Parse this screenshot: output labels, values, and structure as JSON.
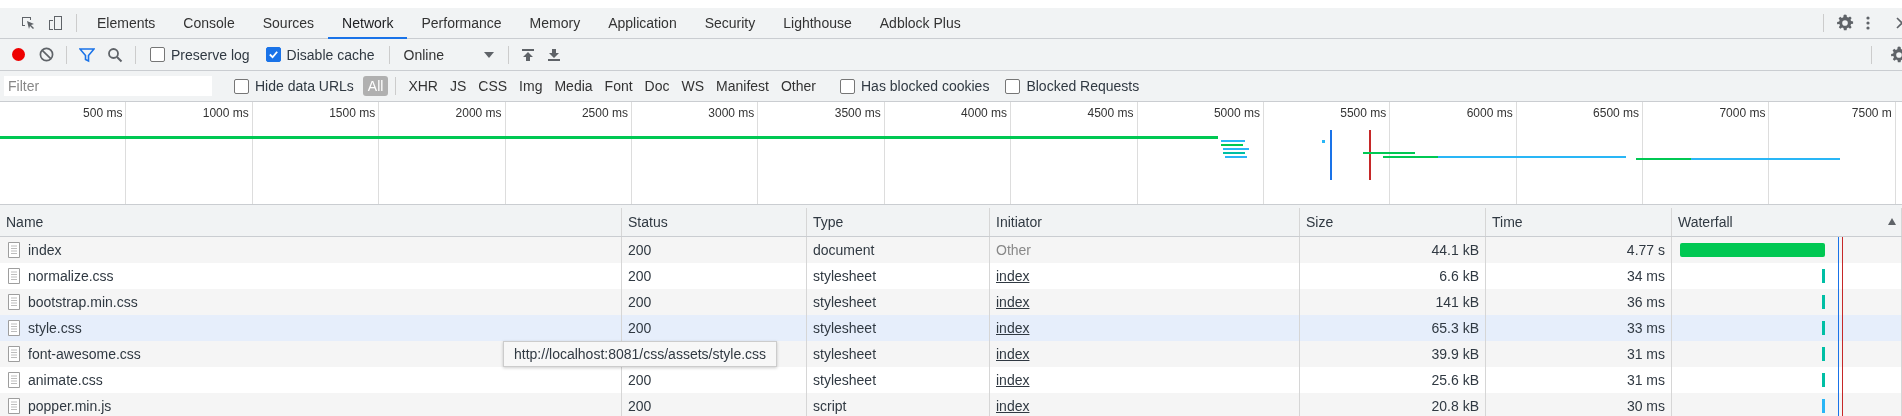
{
  "tabs": [
    {
      "label": "Elements",
      "selected": false
    },
    {
      "label": "Console",
      "selected": false
    },
    {
      "label": "Sources",
      "selected": false
    },
    {
      "label": "Network",
      "selected": true
    },
    {
      "label": "Performance",
      "selected": false
    },
    {
      "label": "Memory",
      "selected": false
    },
    {
      "label": "Application",
      "selected": false
    },
    {
      "label": "Security",
      "selected": false
    },
    {
      "label": "Lighthouse",
      "selected": false
    },
    {
      "label": "Adblock Plus",
      "selected": false
    }
  ],
  "toolbar": {
    "recording": true,
    "filter_active": true,
    "preserve_log": {
      "label": "Preserve log",
      "checked": false
    },
    "disable_cache": {
      "label": "Disable cache",
      "checked": true
    },
    "throttling": "Online"
  },
  "filter_bar": {
    "placeholder": "Filter",
    "hide_data_urls": {
      "label": "Hide data URLs",
      "checked": false
    },
    "types": [
      {
        "label": "All",
        "selected": true
      },
      {
        "label": "XHR",
        "selected": false
      },
      {
        "label": "JS",
        "selected": false
      },
      {
        "label": "CSS",
        "selected": false
      },
      {
        "label": "Img",
        "selected": false
      },
      {
        "label": "Media",
        "selected": false
      },
      {
        "label": "Font",
        "selected": false
      },
      {
        "label": "Doc",
        "selected": false
      },
      {
        "label": "WS",
        "selected": false
      },
      {
        "label": "Manifest",
        "selected": false
      },
      {
        "label": "Other",
        "selected": false
      }
    ],
    "has_blocked_cookies": {
      "label": "Has blocked cookies",
      "checked": false
    },
    "blocked_requests": {
      "label": "Blocked Requests",
      "checked": false
    }
  },
  "overview": {
    "ticks": [
      "500 ms",
      "1000 ms",
      "1500 ms",
      "2000 ms",
      "2500 ms",
      "3000 ms",
      "3500 ms",
      "4000 ms",
      "4500 ms",
      "5000 ms",
      "5500 ms",
      "6000 ms",
      "6500 ms",
      "7000 ms",
      "7500 m"
    ]
  },
  "table": {
    "columns": [
      "Name",
      "Status",
      "Type",
      "Initiator",
      "Size",
      "Time",
      "Waterfall"
    ],
    "rows": [
      {
        "name": "index",
        "status": "200",
        "type": "document",
        "initiator": "Other",
        "initiator_link": false,
        "size": "44.1 kB",
        "time": "4.77 s",
        "hovered": false,
        "kind": "long",
        "color": "#00c853"
      },
      {
        "name": "normalize.css",
        "status": "200",
        "type": "stylesheet",
        "initiator": "index",
        "initiator_link": true,
        "size": "6.6 kB",
        "time": "34 ms",
        "hovered": false,
        "kind": "short",
        "color": "#00bfa5"
      },
      {
        "name": "bootstrap.min.css",
        "status": "200",
        "type": "stylesheet",
        "initiator": "index",
        "initiator_link": true,
        "size": "141 kB",
        "time": "36 ms",
        "hovered": false,
        "kind": "short",
        "color": "#00bfa5"
      },
      {
        "name": "style.css",
        "status": "200",
        "type": "stylesheet",
        "initiator": "index",
        "initiator_link": true,
        "size": "65.3 kB",
        "time": "33 ms",
        "hovered": true,
        "kind": "short",
        "color": "#00bfa5"
      },
      {
        "name": "font-awesome.css",
        "type": "stylesheet",
        "initiator": "index",
        "initiator_link": true,
        "size": "39.9 kB",
        "time": "31 ms",
        "hovered": false,
        "kind": "short",
        "color": "#00bfa5"
      },
      {
        "name": "animate.css",
        "status": "200",
        "type": "stylesheet",
        "initiator": "index",
        "initiator_link": true,
        "size": "25.6 kB",
        "time": "31 ms",
        "hovered": false,
        "kind": "short",
        "color": "#00bfa5"
      },
      {
        "name": "popper.min.js",
        "status": "200",
        "type": "script",
        "initiator": "index",
        "initiator_link": true,
        "size": "20.8 kB",
        "time": "30 ms",
        "hovered": false,
        "kind": "short",
        "color": "#29b6f6"
      }
    ]
  },
  "tooltip": "http://localhost:8081/css/assets/style.css"
}
